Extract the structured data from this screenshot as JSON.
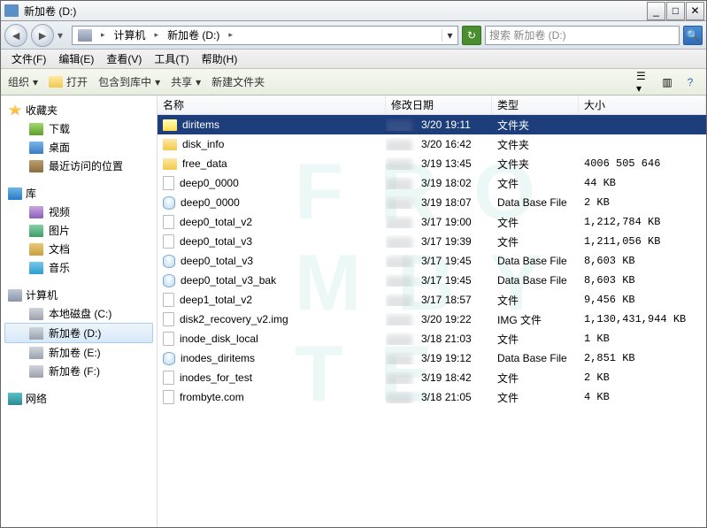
{
  "window": {
    "title": "新加卷 (D:)"
  },
  "nav": {
    "root": "计算机",
    "current": "新加卷 (D:)"
  },
  "search": {
    "placeholder": "搜索 新加卷 (D:)"
  },
  "menus": [
    "文件(F)",
    "编辑(E)",
    "查看(V)",
    "工具(T)",
    "帮助(H)"
  ],
  "toolbar": {
    "organize": "组织",
    "open": "打开",
    "include": "包含到库中",
    "share": "共享",
    "newfolder": "新建文件夹"
  },
  "sidebar": {
    "fav": {
      "label": "收藏夹",
      "items": [
        "下载",
        "桌面",
        "最近访问的位置"
      ]
    },
    "lib": {
      "label": "库",
      "items": [
        "视频",
        "图片",
        "文档",
        "音乐"
      ]
    },
    "comp": {
      "label": "计算机",
      "items": [
        "本地磁盘 (C:)",
        "新加卷 (D:)",
        "新加卷 (E:)",
        "新加卷 (F:)"
      ]
    },
    "net": {
      "label": "网络"
    }
  },
  "columns": {
    "name": "名称",
    "date": "修改日期",
    "type": "类型",
    "size": "大小"
  },
  "files": [
    {
      "name": "diritems",
      "date": "3/20 19:11",
      "type": "文件夹",
      "size": "",
      "icon": "folder",
      "sel": true
    },
    {
      "name": "disk_info",
      "date": "3/20 16:42",
      "type": "文件夹",
      "size": "",
      "icon": "folder"
    },
    {
      "name": "free_data",
      "date": "3/19 13:45",
      "type": "文件夹",
      "size": "4006 505 646",
      "icon": "folder"
    },
    {
      "name": "deep0_0000",
      "date": "3/19 18:02",
      "type": "文件",
      "size": "44 KB",
      "icon": "file"
    },
    {
      "name": "deep0_0000",
      "date": "3/19 18:07",
      "type": "Data Base File",
      "size": "2 KB",
      "icon": "db"
    },
    {
      "name": "deep0_total_v2",
      "date": "3/17 19:00",
      "type": "文件",
      "size": "1,212,784 KB",
      "icon": "file"
    },
    {
      "name": "deep0_total_v3",
      "date": "3/17 19:39",
      "type": "文件",
      "size": "1,211,056 KB",
      "icon": "file"
    },
    {
      "name": "deep0_total_v3",
      "date": "3/17 19:45",
      "type": "Data Base File",
      "size": "8,603 KB",
      "icon": "db"
    },
    {
      "name": "deep0_total_v3_bak",
      "date": "3/17 19:45",
      "type": "Data Base File",
      "size": "8,603 KB",
      "icon": "db"
    },
    {
      "name": "deep1_total_v2",
      "date": "3/17 18:57",
      "type": "文件",
      "size": "9,456 KB",
      "icon": "file"
    },
    {
      "name": "disk2_recovery_v2.img",
      "date": "3/20 19:22",
      "type": "IMG 文件",
      "size": "1,130,431,944 KB",
      "icon": "file"
    },
    {
      "name": "inode_disk_local",
      "date": "3/18 21:03",
      "type": "文件",
      "size": "1 KB",
      "icon": "file"
    },
    {
      "name": "inodes_diritems",
      "date": "3/19 19:12",
      "type": "Data Base File",
      "size": "2,851 KB",
      "icon": "db"
    },
    {
      "name": "inodes_for_test",
      "date": "3/19 18:42",
      "type": "文件",
      "size": "2 KB",
      "icon": "file"
    },
    {
      "name": "frombyte.com",
      "date": "3/18 21:05",
      "type": "文件",
      "size": "4 KB",
      "icon": "file"
    }
  ]
}
